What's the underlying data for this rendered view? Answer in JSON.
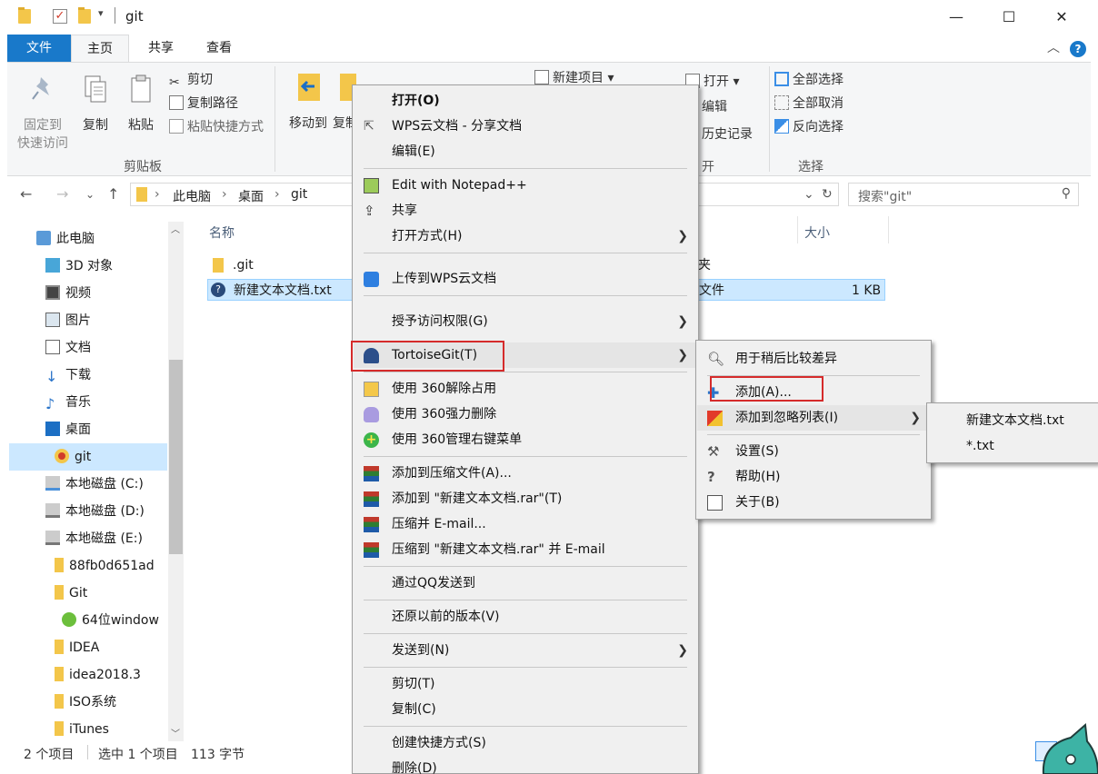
{
  "window": {
    "title": "git",
    "minimize": "—",
    "maximize": "☐",
    "close": "✕"
  },
  "ribbon_tabs": {
    "file": "文件",
    "home": "主页",
    "share": "共享",
    "view": "查看",
    "help": "?"
  },
  "ribbon": {
    "pin_quick_access": "固定到\n快速访问",
    "pin_line1": "固定到",
    "pin_line2": "快速访问",
    "copy": "复制",
    "paste": "粘贴",
    "cut": "剪切",
    "copy_path": "复制路径",
    "paste_shortcut": "粘贴快捷方式",
    "clipboard_group": "剪贴板",
    "move_to": "移动到",
    "copy_to": "复制",
    "new_item": "新建项目",
    "open": "打开",
    "edit": "编辑",
    "history": "历史记录",
    "open_group": "打开",
    "select_all": "全部选择",
    "select_none": "全部取消",
    "invert_selection": "反向选择",
    "select_group": "选择"
  },
  "address": {
    "crumbs": [
      "此电脑",
      "桌面",
      "git"
    ],
    "search_placeholder": "搜索\"git\""
  },
  "sidebar": {
    "items": [
      {
        "label": "此电脑",
        "icon": "pc-icon"
      },
      {
        "label": "3D 对象",
        "icon": "3d-objects-icon"
      },
      {
        "label": "视频",
        "icon": "video-icon"
      },
      {
        "label": "图片",
        "icon": "pictures-icon"
      },
      {
        "label": "文档",
        "icon": "documents-icon"
      },
      {
        "label": "下载",
        "icon": "download-icon"
      },
      {
        "label": "音乐",
        "icon": "music-icon"
      },
      {
        "label": "桌面",
        "icon": "desktop-icon"
      },
      {
        "label": "git",
        "icon": "git-folder-icon"
      },
      {
        "label": "本地磁盘 (C:)",
        "icon": "drive-icon"
      },
      {
        "label": "本地磁盘 (D:)",
        "icon": "drive-icon"
      },
      {
        "label": "本地磁盘 (E:)",
        "icon": "drive-icon"
      },
      {
        "label": "88fb0d651ad",
        "icon": "folder-icon"
      },
      {
        "label": "Git",
        "icon": "folder-icon"
      },
      {
        "label": "64位window",
        "icon": "app-icon"
      },
      {
        "label": "IDEA",
        "icon": "folder-icon"
      },
      {
        "label": "idea2018.3",
        "icon": "folder-icon"
      },
      {
        "label": "ISO系统",
        "icon": "folder-icon"
      },
      {
        "label": "iTunes",
        "icon": "folder-icon"
      }
    ]
  },
  "file_list": {
    "col_name": "名称",
    "col_size": "大小",
    "rows": [
      {
        "name": ".git",
        "type_partial": "夹",
        "size": ""
      },
      {
        "name": "新建文本文档.txt",
        "type_partial": "文件",
        "size": "1 KB"
      }
    ]
  },
  "status": {
    "count": "2 个项目",
    "selected": "选中 1 个项目",
    "bytes": "113 字节"
  },
  "context_menu": {
    "items": {
      "open": "打开(O)",
      "wps_share": "WPS云文档 - 分享文档",
      "edit": "编辑(E)",
      "notepadpp": "Edit with Notepad++",
      "share": "共享",
      "open_with": "打开方式(H)",
      "upload_wps": "上传到WPS云文档",
      "grant_access": "授予访问权限(G)",
      "tortoisegit": "TortoiseGit(T)",
      "unlock_360": "使用 360解除占用",
      "delete_360": "使用 360强力删除",
      "manage_360": "使用 360管理右键菜单",
      "add_archive": "添加到压缩文件(A)...",
      "add_rar": "添加到 \"新建文本文档.rar\"(T)",
      "compress_email": "压缩并 E-mail...",
      "compress_rar_email": "压缩到 \"新建文本文档.rar\" 并 E-mail",
      "qq_send": "通过QQ发送到",
      "restore_prev": "还原以前的版本(V)",
      "send_to": "发送到(N)",
      "cut": "剪切(T)",
      "copy": "复制(C)",
      "create_shortcut": "创建快捷方式(S)",
      "delete": "删除(D)"
    }
  },
  "tortoise_menu": {
    "diff_later": "用于稍后比较差异",
    "add": "添加(A)...",
    "add_ignore": "添加到忽略列表(I)",
    "settings": "设置(S)",
    "help": "帮助(H)",
    "about": "关于(B)"
  },
  "ignore_menu": {
    "file": "新建文本文档.txt",
    "ext": "*.txt"
  },
  "colors": {
    "accent": "#1979ca",
    "selection": "#cce8ff",
    "highlight_box": "#d52b2b"
  }
}
